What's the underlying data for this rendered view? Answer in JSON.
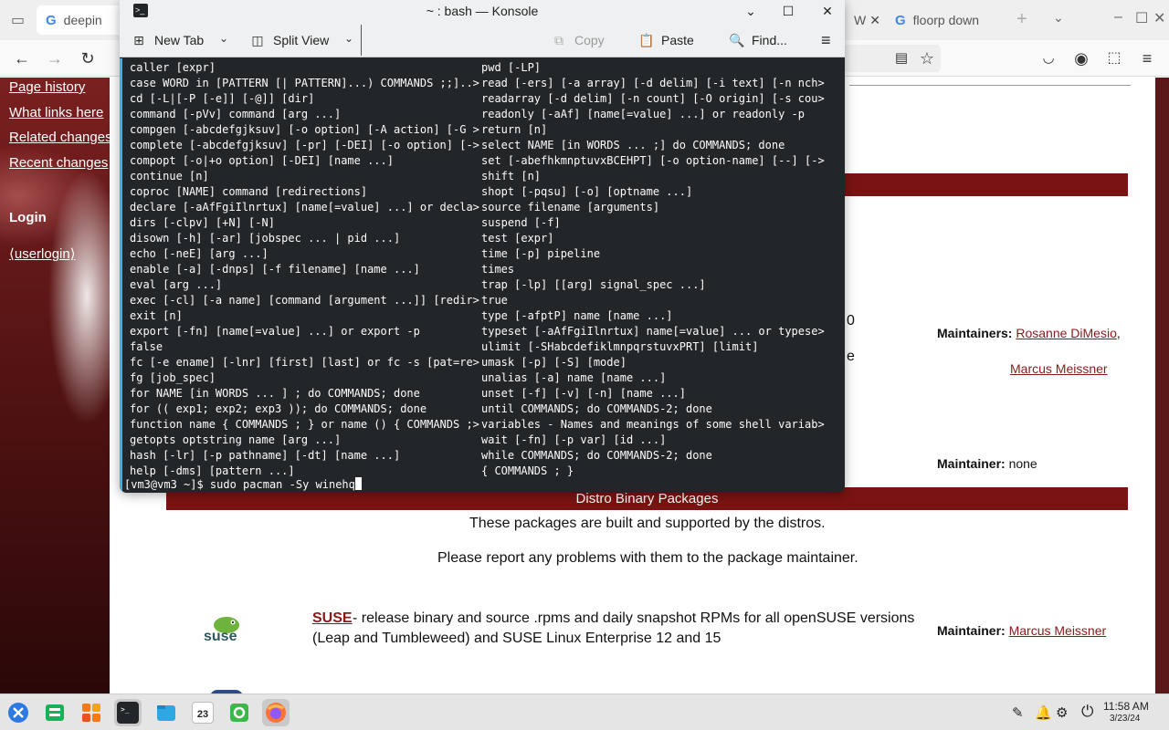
{
  "browser": {
    "tabs": [
      {
        "label": "deepin"
      },
      {
        "label": "W"
      },
      {
        "label": "floorp down"
      }
    ]
  },
  "sidebar": {
    "links": [
      "Page history",
      "What links here",
      "Related changes",
      "Recent changes"
    ],
    "login_heading": "Login",
    "userlogin": "⟨userlogin⟩"
  },
  "page": {
    "fragment_0": "0",
    "fragment_e": "e",
    "maintainers_label": "Maintainers:",
    "maintainer_1": "Rosanne DiMesio",
    "maintainer_1_sep": ",",
    "maintainer_2": "Marcus Meissner",
    "maintainer_label": "Maintainer:",
    "maintainer_none": "none",
    "section_title": "Distro Binary Packages",
    "intro_1": "These packages are built and supported by the distros.",
    "intro_2": "Please report any problems with them to the package maintainer.",
    "suse_logo_text": "suse",
    "suse_link": "SUSE",
    "suse_desc_1": " - release binary and source .rpms and daily snapshot RPMs for all openSUSE versions",
    "suse_desc_2": "(Leap and Tumbleweed) and SUSE Linux Enterprise 12 and 15",
    "suse_maintainer_label": "Maintainer:",
    "suse_maintainer": "Marcus Meissner"
  },
  "konsole": {
    "title": "~ : bash — Konsole",
    "toolbar": {
      "new_tab": "New Tab",
      "split_view": "Split View",
      "copy": "Copy",
      "paste": "Paste",
      "find": "Find..."
    },
    "left_lines": [
      "caller [expr]",
      "case WORD in [PATTERN [| PATTERN]...) COMMANDS ;;]..>",
      "cd [-L|[-P [-e]] [-@]] [dir]",
      "command [-pVv] command [arg ...]",
      "compgen [-abcdefgjksuv] [-o option] [-A action] [-G >",
      "complete [-abcdefgjksuv] [-pr] [-DEI] [-o option] [->",
      "compopt [-o|+o option] [-DEI] [name ...]",
      "continue [n]",
      "coproc [NAME] command [redirections]",
      "declare [-aAfFgiIlnrtux] [name[=value] ...] or decla>",
      "dirs [-clpv] [+N] [-N]",
      "disown [-h] [-ar] [jobspec ... | pid ...]",
      "echo [-neE] [arg ...]",
      "enable [-a] [-dnps] [-f filename] [name ...]",
      "eval [arg ...]",
      "exec [-cl] [-a name] [command [argument ...]] [redir>",
      "exit [n]",
      "export [-fn] [name[=value] ...] or export -p",
      "false",
      "fc [-e ename] [-lnr] [first] [last] or fc -s [pat=re>",
      "fg [job_spec]",
      "for NAME [in WORDS ... ] ; do COMMANDS; done",
      "for (( exp1; exp2; exp3 )); do COMMANDS; done",
      "function name { COMMANDS ; } or name () { COMMANDS ;>",
      "getopts optstring name [arg ...]",
      "hash [-lr] [-p pathname] [-dt] [name ...]",
      "help [-dms] [pattern ...]"
    ],
    "right_lines": [
      "pwd [-LP]",
      "read [-ers] [-a array] [-d delim] [-i text] [-n nch>",
      "readarray [-d delim] [-n count] [-O origin] [-s cou>",
      "readonly [-aAf] [name[=value] ...] or readonly -p",
      "return [n]",
      "select NAME [in WORDS ... ;] do COMMANDS; done",
      "set [-abefhkmnptuvxBCEHPT] [-o option-name] [--] [->",
      "shift [n]",
      "shopt [-pqsu] [-o] [optname ...]",
      "source filename [arguments]",
      "suspend [-f]",
      "test [expr]",
      "time [-p] pipeline",
      "times",
      "trap [-lp] [[arg] signal_spec ...]",
      "true",
      "type [-afptP] name [name ...]",
      "typeset [-aAfFgiIlnrtux] name[=value] ... or typese>",
      "ulimit [-SHabcdefiklmnpqrstuvxPRT] [limit]",
      "umask [-p] [-S] [mode]",
      "unalias [-a] name [name ...]",
      "unset [-f] [-v] [-n] [name ...]",
      "until COMMANDS; do COMMANDS-2; done",
      "variables - Names and meanings of some shell variab>",
      "wait [-fn] [-p var] [id ...]",
      "while COMMANDS; do COMMANDS-2; done",
      "{ COMMANDS ; }"
    ],
    "prompt": "[vm3@vm3 ~]$ sudo pacman -Sy winehq"
  },
  "taskbar": {
    "calendar_day": "23",
    "time": "11:58 AM",
    "date": "3/23/24"
  },
  "colors": {
    "wiki_red": "#7a1412",
    "terminal_bg": "#232629",
    "terminal_fg": "#fcfcfc",
    "link_red": "#8a1a1a",
    "focus_blue": "#3daee9"
  }
}
